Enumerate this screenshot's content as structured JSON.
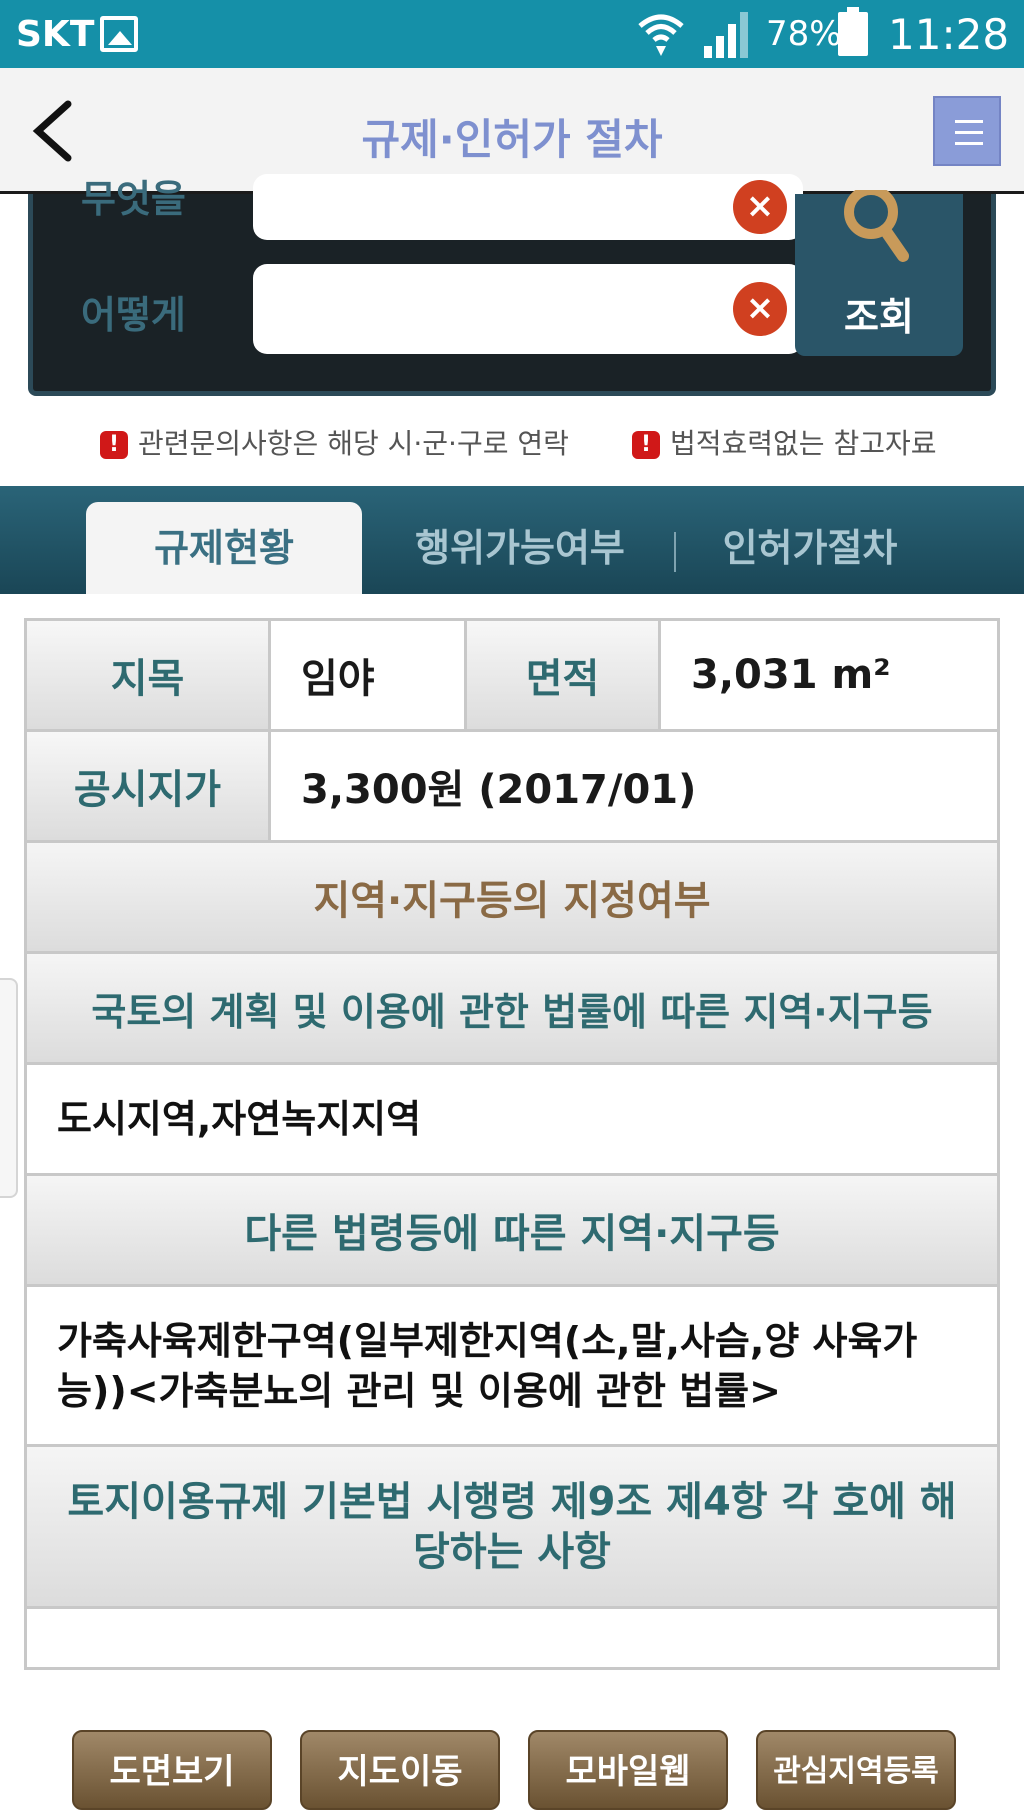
{
  "status_bar": {
    "carrier": "SKT",
    "battery": "78%",
    "time": "11:28"
  },
  "header": {
    "title": "규제·인허가 절차"
  },
  "search": {
    "what_label": "무엇을",
    "how_label": "어떻게",
    "what_value": "",
    "how_value": "",
    "button_label": "조회"
  },
  "notices": [
    "관련문의사항은 해당 시·군·구로 연락",
    "법적효력없는 참고자료"
  ],
  "tabs": [
    {
      "label": "규제현황",
      "active": true
    },
    {
      "label": "행위가능여부",
      "active": false
    },
    {
      "label": "인허가절차",
      "active": false
    }
  ],
  "land_info": {
    "category_label": "지목",
    "category_value": "임야",
    "area_label": "면적",
    "area_value": "3,031 m²",
    "price_label": "공시지가",
    "price_value": "3,300원 (2017/01)"
  },
  "sections": {
    "designation_title": "지역·지구등의 지정여부",
    "national_law_title": "국토의 계획 및 이용에 관한 법률에 따른 지역·지구등",
    "national_law_value": "도시지역,자연녹지지역",
    "other_law_title": "다른 법령등에 따른 지역·지구등",
    "other_law_value": "가축사육제한구역(일부제한지역(소,말,사슴,양 사육가능))<가축분뇨의 관리 및 이용에 관한 법률>",
    "enforcement_title": "토지이용규제 기본법 시행령 제9조 제4항 각 호에 해당하는 사항",
    "enforcement_value": ""
  },
  "bottom_buttons": [
    "도면보기",
    "지도이동",
    "모바일웹",
    "관심지역등록"
  ],
  "colors": {
    "status_bar": "#1590a8",
    "title": "#7e90cf",
    "tab_bar": "#2a6478",
    "brown_button": "#8a7050"
  }
}
